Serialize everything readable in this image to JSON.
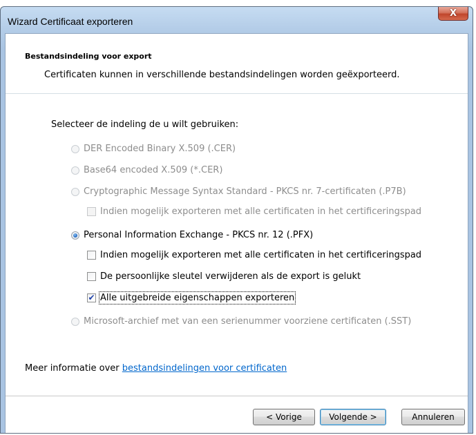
{
  "window": {
    "title": "Wizard Certificaat exporteren",
    "close_glyph": "X"
  },
  "header": {
    "title": "Bestandsindeling voor export",
    "subtitle": "Certificaten kunnen in verschillende bestandsindelingen worden geëxporteerd."
  },
  "prompt": "Selecteer de indeling de u wilt gebruiken:",
  "options": {
    "der": {
      "label": "DER Encoded Binary X.509 (.CER)",
      "selected": false,
      "enabled": false
    },
    "base64": {
      "label": "Base64 encoded X.509 (*.CER)",
      "selected": false,
      "enabled": false
    },
    "pkcs7": {
      "label": "Cryptographic Message Syntax Standard - PKCS nr. 7-certificaten (.P7B)",
      "selected": false,
      "enabled": false
    },
    "pkcs7_include_all": {
      "label": "Indien mogelijk exporteren met alle certificaten in het certificeringspad",
      "checked": false,
      "enabled": false
    },
    "pfx": {
      "label": "Personal Information Exchange - PKCS nr. 12 (.PFX)",
      "selected": true,
      "enabled": true
    },
    "pfx_include_all": {
      "label": "Indien mogelijk exporteren met alle certificaten in het certificeringspad",
      "checked": false,
      "enabled": true
    },
    "pfx_delete_key": {
      "label": "De persoonlijke sleutel verwijderen als de export is gelukt",
      "checked": false,
      "enabled": true
    },
    "pfx_export_props": {
      "label": "Alle uitgebreide eigenschappen exporteren",
      "checked": true,
      "enabled": true
    },
    "sst": {
      "label": "Microsoft-archief met van een serienummer voorziene certificaten (.SST)",
      "selected": false,
      "enabled": false
    }
  },
  "more_info": {
    "prefix": "Meer informatie over ",
    "link": "bestandsindelingen voor certificaten"
  },
  "buttons": {
    "back": "< Vorige",
    "next": "Volgende >",
    "cancel": "Annuleren"
  }
}
